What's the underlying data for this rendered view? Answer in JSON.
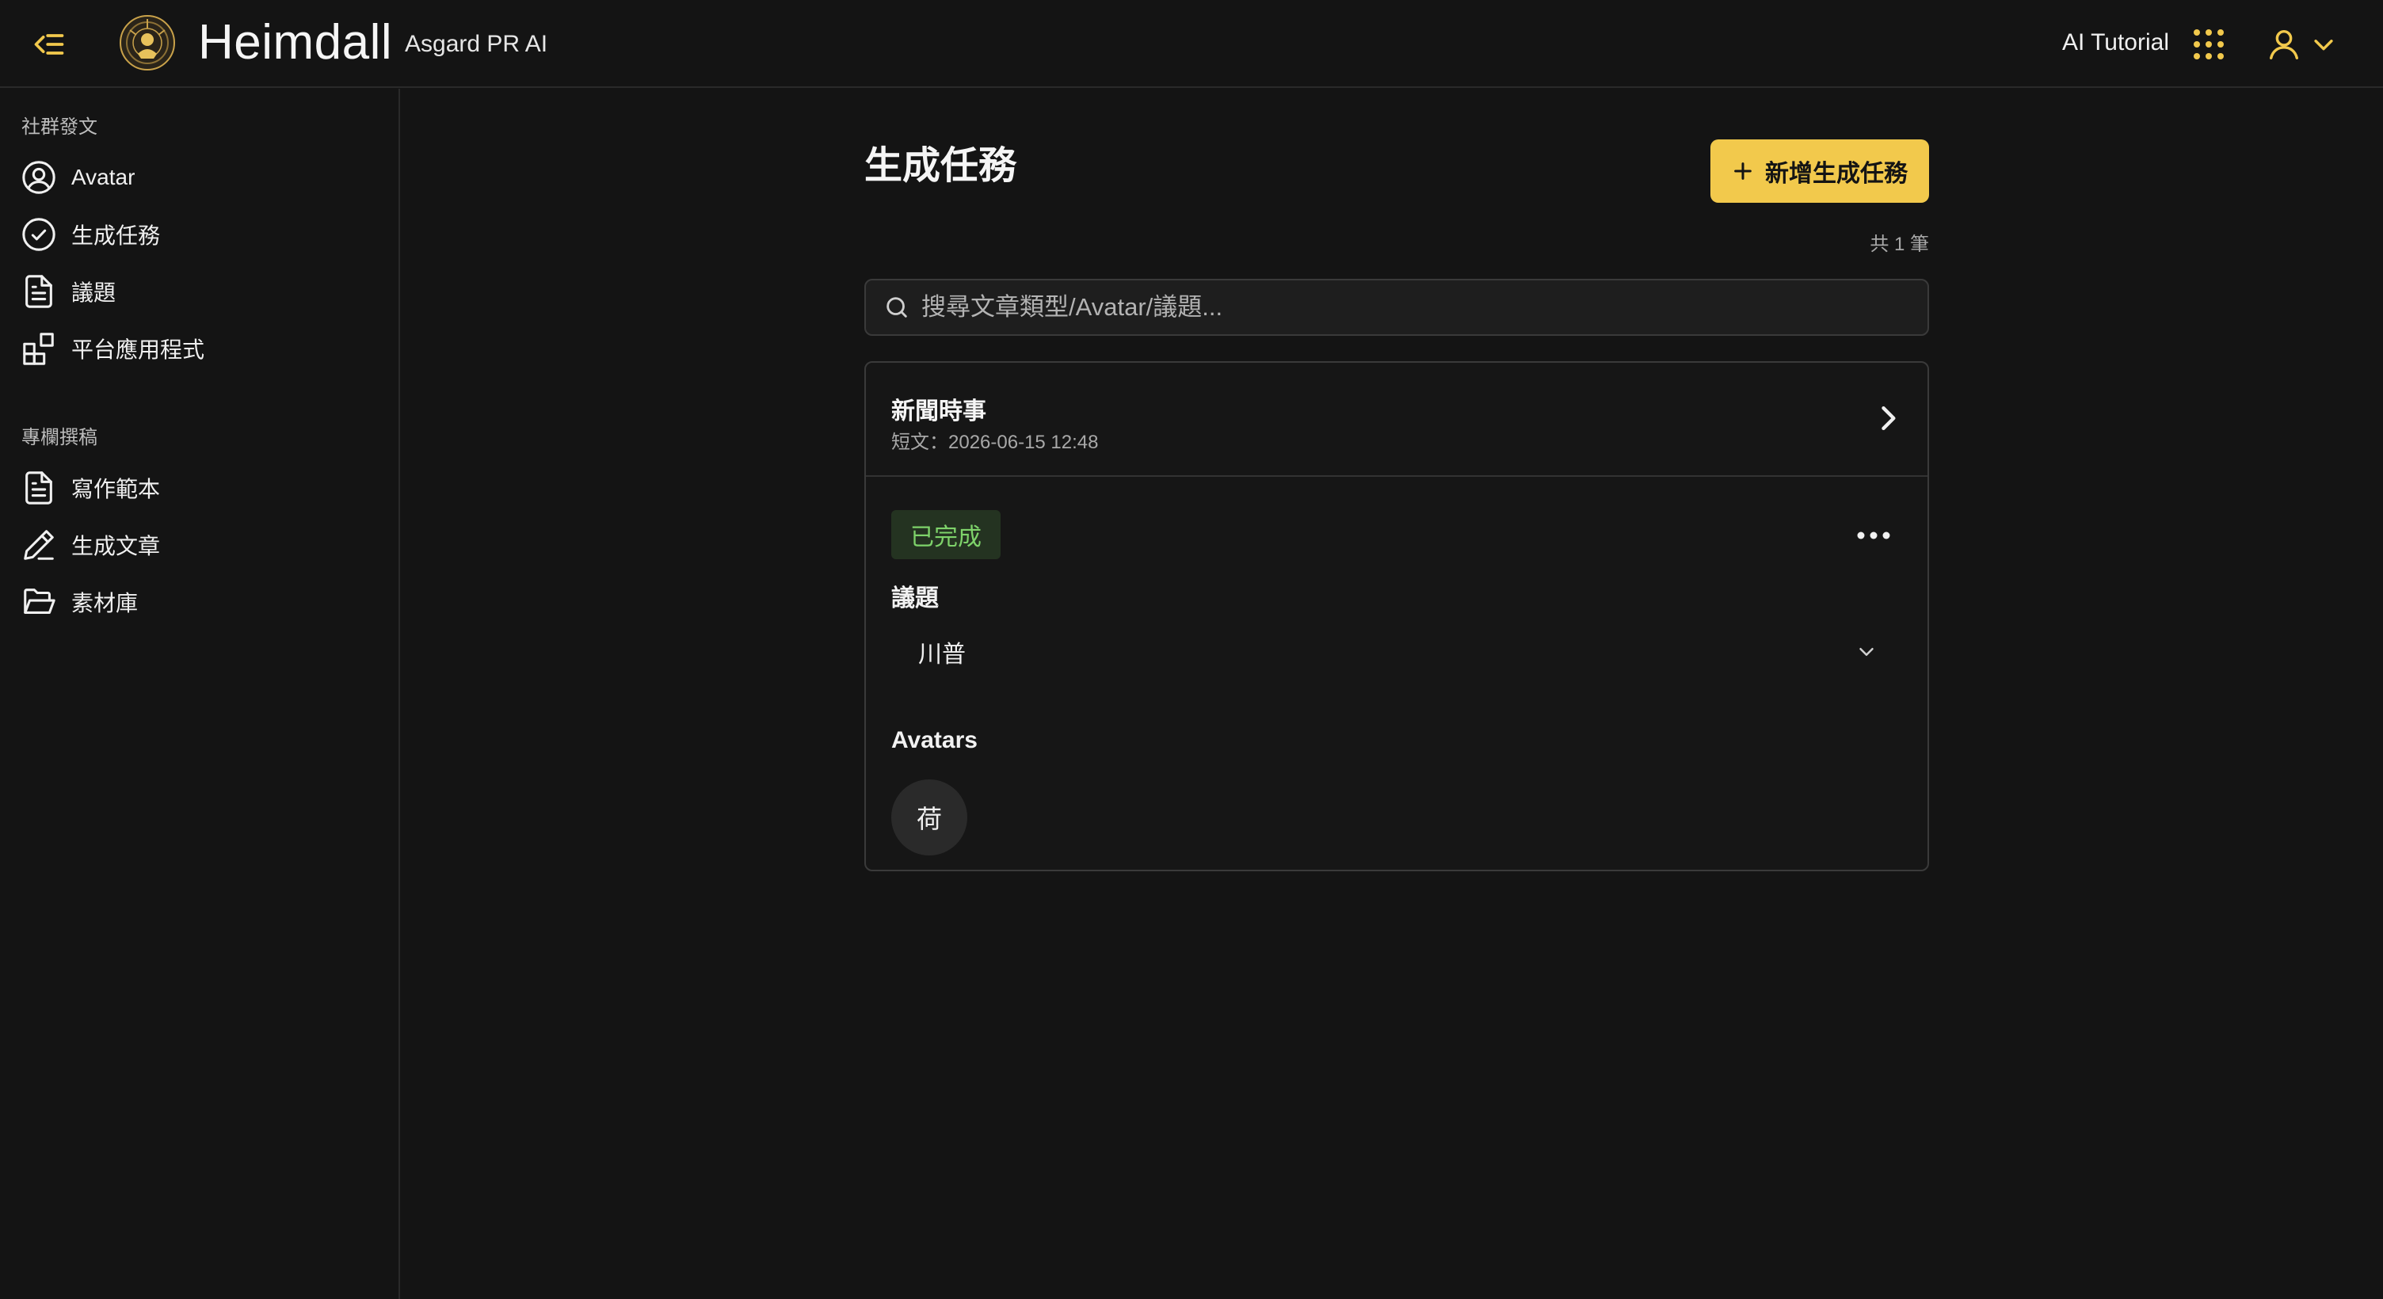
{
  "header": {
    "brand_name": "Heimdall",
    "brand_sub": "Asgard PR AI",
    "tutorial_label": "AI Tutorial",
    "icons": [
      "collapse-sidebar-icon",
      "heimdall-logo",
      "apps-grid-icon",
      "user-icon",
      "chevron-down-icon"
    ],
    "accent_color": "#f2c94c"
  },
  "sidebar": {
    "section1_title": "社群發文",
    "section1_items": [
      {
        "label": "Avatar",
        "icon": "user-circle-icon"
      },
      {
        "label": "生成任務",
        "icon": "check-circle-icon"
      },
      {
        "label": "議題",
        "icon": "document-icon"
      },
      {
        "label": "平台應用程式",
        "icon": "apps-icon"
      }
    ],
    "section2_title": "專欄撰稿",
    "section2_items": [
      {
        "label": "寫作範本",
        "icon": "document-icon"
      },
      {
        "label": "生成文章",
        "icon": "pen-icon"
      },
      {
        "label": "素材庫",
        "icon": "folder-open-icon"
      }
    ]
  },
  "main": {
    "page_title": "生成任務",
    "add_button_label": "新增生成任務",
    "count_text": "共 1 筆",
    "search_placeholder": "搜尋文章類型/Avatar/議題...",
    "task": {
      "title": "新聞時事",
      "meta": "短文：2026-06-15 12:48",
      "status": "已完成",
      "status_color": "#7ed36a",
      "topic_label": "議題",
      "topic_value": "川普",
      "avatars_label": "Avatars",
      "avatar_initial": "荷"
    }
  }
}
